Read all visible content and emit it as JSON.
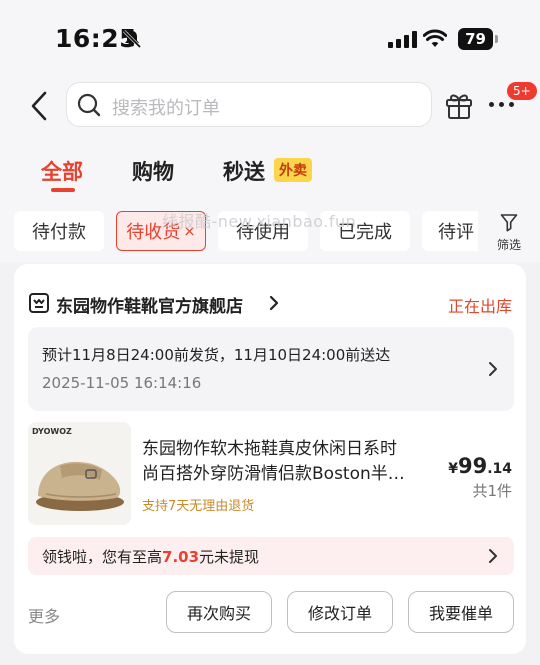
{
  "status_bar": {
    "time": "16:25",
    "battery": "79"
  },
  "search": {
    "placeholder": "搜索我的订单"
  },
  "header": {
    "more_badge": "5+"
  },
  "tabs": [
    {
      "label": "全部",
      "active": true
    },
    {
      "label": "购物",
      "active": false
    },
    {
      "label": "秒送",
      "active": false,
      "badge": "外卖"
    }
  ],
  "filters": {
    "chips": [
      {
        "label": "待付款",
        "active": false
      },
      {
        "label": "待收货",
        "active": true,
        "close": "×"
      },
      {
        "label": "待使用",
        "active": false
      },
      {
        "label": "已完成",
        "active": false
      },
      {
        "label": "待评",
        "active": false
      }
    ],
    "filter_label": "筛选",
    "watermark": "线报酷-new.xianbao.fun"
  },
  "order": {
    "store_name": "东园物作鞋靴官方旗舰店",
    "status": "正在出库",
    "shipping_estimate": "预计11月8日24:00前发货，11月10日24:00前送达",
    "order_time": "2025-11-05 16:14:16",
    "product": {
      "brand_mark": "DYOWOZ",
      "title_line1": "东园物作软木拖鞋真皮休闲日系时",
      "title_line2": "尚百搭外穿防滑情侣款Boston半…",
      "return_policy": "支持7天无理由退货",
      "price_symbol": "¥",
      "price_int": "99",
      "price_dec": ".14",
      "quantity": "共1件"
    },
    "cash": {
      "prefix": "领钱啦，您有至高",
      "amount": "7.03",
      "suffix": "元未提现"
    },
    "more": "更多",
    "buttons": {
      "rebuy": "再次购买",
      "modify": "修改订单",
      "urge": "我要催单"
    }
  },
  "colors": {
    "accent": "#e8412f",
    "status": "#e0472c",
    "tag": "#c98b2d",
    "badge": "#fbd64a"
  }
}
